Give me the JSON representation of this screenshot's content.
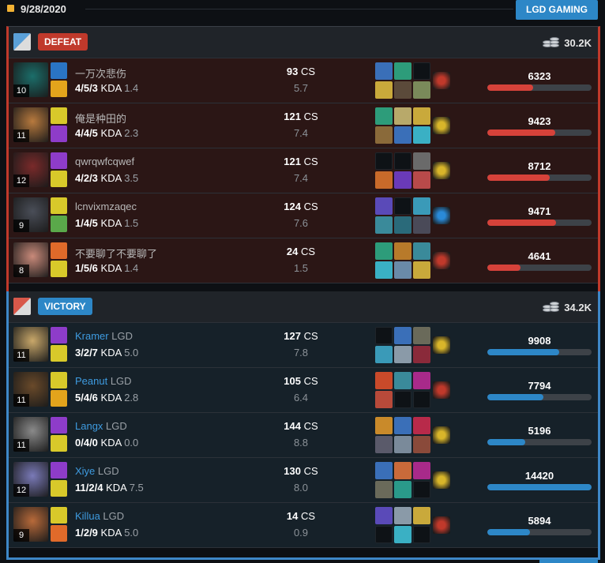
{
  "header": {
    "date": "9/28/2020",
    "team_button": "LGD GAMING"
  },
  "colors": {
    "defeat": "#c0392b",
    "victory": "#2d87c7",
    "date_marker": "#f2b233"
  },
  "teams": [
    {
      "result": "DEFEAT",
      "gold": "30.2K",
      "max_damage": 14420,
      "players": [
        {
          "level": "10",
          "name": "一万次悲伤",
          "team_tag": "",
          "kda": "4/5/3",
          "kda_label": "KDA",
          "kda_ratio": "1.4",
          "cs": "93",
          "cs_label": "CS",
          "cs_per_min": "5.7",
          "damage": "6323",
          "champ_color": "#1b6e6a",
          "spells": [
            "#2a74c4",
            "#e3a41c"
          ],
          "items": [
            "#3a6fb8",
            "#2d9c7a",
            "",
            "#c9a93b",
            "#5b4a3a",
            "#7a8a5a"
          ],
          "ward": "red"
        },
        {
          "level": "11",
          "name": "俺是种田的",
          "team_tag": "",
          "kda": "4/4/5",
          "kda_label": "KDA",
          "kda_ratio": "2.3",
          "cs": "121",
          "cs_label": "CS",
          "cs_per_min": "7.4",
          "damage": "9423",
          "champ_color": "#b87a3e",
          "spells": [
            "#d8c92a",
            "#8e3cc9"
          ],
          "items": [
            "#2d9c7a",
            "#b8a96a",
            "#c9a93b",
            "#8a6a3a",
            "#3a6fb8",
            "#3ab0c4"
          ],
          "ward": "yellow"
        },
        {
          "level": "12",
          "name": "qwrqwfcqwef",
          "team_tag": "",
          "kda": "4/2/3",
          "kda_label": "KDA",
          "kda_ratio": "3.5",
          "cs": "121",
          "cs_label": "CS",
          "cs_per_min": "7.4",
          "damage": "8712",
          "champ_color": "#7a2a2a",
          "spells": [
            "#8e3cc9",
            "#d8c92a"
          ],
          "items": [
            "",
            "",
            "#6a6a6a",
            "#c96a2a",
            "#6a3ab8",
            "#b84a4a"
          ],
          "ward": "yellow"
        },
        {
          "level": "9",
          "name": "lcnvixmzaqec",
          "team_tag": "",
          "kda": "1/4/5",
          "kda_label": "KDA",
          "kda_ratio": "1.5",
          "cs": "124",
          "cs_label": "CS",
          "cs_per_min": "7.6",
          "damage": "9471",
          "champ_color": "#4a4e58",
          "spells": [
            "#d8c92a",
            "#5aa84a"
          ],
          "items": [
            "#5a4ab8",
            "",
            "#3a9ab8",
            "#3a8a9a",
            "#2a6a7a",
            "#4a4a58"
          ],
          "ward": "blue"
        },
        {
          "level": "8",
          "name": "不要聊了不要聊了",
          "team_tag": "",
          "kda": "1/5/6",
          "kda_label": "KDA",
          "kda_ratio": "1.4",
          "cs": "24",
          "cs_label": "CS",
          "cs_per_min": "1.5",
          "damage": "4641",
          "champ_color": "#c98a7a",
          "spells": [
            "#e06a2a",
            "#d8c92a"
          ],
          "items": [
            "#2d9c7a",
            "#b87a2a",
            "#3a8a9a",
            "#3ab0c4",
            "#6a8aa8",
            "#c9a93b"
          ],
          "ward": "red"
        }
      ]
    },
    {
      "result": "VICTORY",
      "gold": "34.2K",
      "max_damage": 14420,
      "players": [
        {
          "level": "11",
          "name": "Kramer",
          "team_tag": "LGD",
          "kda": "3/2/7",
          "kda_label": "KDA",
          "kda_ratio": "5.0",
          "cs": "127",
          "cs_label": "CS",
          "cs_per_min": "7.8",
          "damage": "9908",
          "champ_color": "#c9a86a",
          "spells": [
            "#8e3cc9",
            "#d8c92a"
          ],
          "items": [
            "",
            "#3a6fb8",
            "#6a6a5a",
            "#3a9ab8",
            "#8a9aa8",
            "#8a2a3a"
          ],
          "ward": "yellow"
        },
        {
          "level": "11",
          "name": "Peanut",
          "team_tag": "LGD",
          "kda": "5/4/6",
          "kda_label": "KDA",
          "kda_ratio": "2.8",
          "cs": "105",
          "cs_label": "CS",
          "cs_per_min": "6.4",
          "damage": "7794",
          "champ_color": "#6a4a2a",
          "spells": [
            "#d8c92a",
            "#e3a41c"
          ],
          "items": [
            "#c94a2a",
            "#3a8a9a",
            "#a82a8a",
            "#b84a3a",
            "",
            ""
          ],
          "ward": "red"
        },
        {
          "level": "11",
          "name": "Langx",
          "team_tag": "LGD",
          "kda": "0/4/0",
          "kda_label": "KDA",
          "kda_ratio": "0.0",
          "cs": "144",
          "cs_label": "CS",
          "cs_per_min": "8.8",
          "damage": "5196",
          "champ_color": "#8a8a8a",
          "spells": [
            "#8e3cc9",
            "#d8c92a"
          ],
          "items": [
            "#c98a2a",
            "#3a6fb8",
            "#b82a4a",
            "#5a5a6a",
            "#7a8a9a",
            "#8a4a3a"
          ],
          "ward": "yellow"
        },
        {
          "level": "12",
          "name": "Xiye",
          "team_tag": "LGD",
          "kda": "11/2/4",
          "kda_label": "KDA",
          "kda_ratio": "7.5",
          "cs": "130",
          "cs_label": "CS",
          "cs_per_min": "8.0",
          "damage": "14420",
          "champ_color": "#7a7ab8",
          "spells": [
            "#8e3cc9",
            "#d8c92a"
          ],
          "items": [
            "#3a6fb8",
            "#c96a3a",
            "#a82a8a",
            "#6a6a5a",
            "#2a9a8a",
            ""
          ],
          "ward": "yellow"
        },
        {
          "level": "9",
          "name": "Killua",
          "team_tag": "LGD",
          "kda": "1/2/9",
          "kda_label": "KDA",
          "kda_ratio": "5.0",
          "cs": "14",
          "cs_label": "CS",
          "cs_per_min": "0.9",
          "damage": "5894",
          "champ_color": "#b86a3a",
          "spells": [
            "#d8c92a",
            "#e06a2a"
          ],
          "items": [
            "#5a4ab8",
            "#8a9aa8",
            "#c9a93b",
            "",
            "#3ab0c4",
            ""
          ],
          "ward": "red"
        }
      ]
    }
  ]
}
